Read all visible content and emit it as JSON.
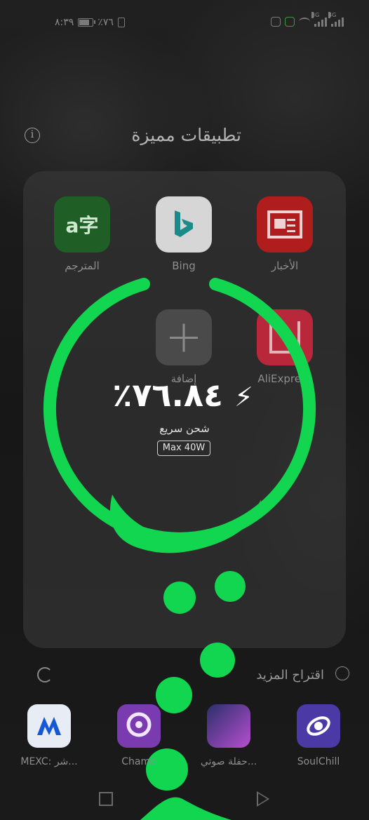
{
  "status_bar": {
    "time": "٨:٣٩",
    "battery_text": "٪٧٦",
    "battery_level": 0.76,
    "network_labels": [
      "3G",
      "4G"
    ]
  },
  "header": {
    "title": "تطبيقات مميزة",
    "info_icon": "info-icon"
  },
  "featured_apps": [
    {
      "label": "المترجم",
      "icon": "translate-icon"
    },
    {
      "label": "Bing",
      "icon": "bing-icon"
    },
    {
      "label": "الأخبار",
      "icon": "news-icon"
    },
    {
      "label": "إضافة",
      "icon": "add-icon"
    },
    {
      "label": "AliExpress",
      "icon": "aliexpress-icon"
    }
  ],
  "charging": {
    "percent_text": "٪٧٦.٨٤",
    "percent_value": 76.84,
    "mode_label": "شحن سريع",
    "power_badge": "Max 40W",
    "accent_color": "#12d650"
  },
  "suggestions": {
    "label": "اقتراح المزيد",
    "apps": [
      {
        "label": "MEXC: شر...",
        "icon": "mexc-icon"
      },
      {
        "label": "Chame",
        "icon": "chame-icon"
      },
      {
        "label": "حفلة صوتي...",
        "icon": "voice-party-icon"
      },
      {
        "label": "SoulChill",
        "icon": "soulchill-icon"
      }
    ]
  }
}
